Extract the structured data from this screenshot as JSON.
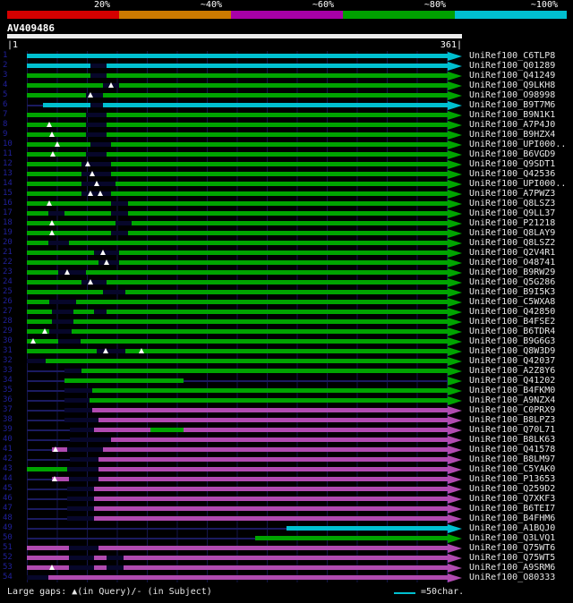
{
  "identity_scale": {
    "labels": [
      "20%",
      "~40%",
      "~60%",
      "~80%",
      "~100%"
    ],
    "colors": [
      "#d40000",
      "#cc7a00",
      "#a800a8",
      "#00a000",
      "#00c0d0"
    ]
  },
  "query": {
    "name": "AV409486",
    "start_label": "|1",
    "end_label": "361|",
    "length": 361
  },
  "footer": {
    "gaps_legend": "Large gaps: ▲(in Query)/- (in Subject)",
    "scale_label": "=50char."
  },
  "colors": {
    "cyan": "#00c0d0",
    "green": "#00a400",
    "magenta": "#b04ab0",
    "navy": "#07072a"
  },
  "hits": [
    {
      "n": 1,
      "label": "UniRef100_C6TLP8",
      "color": "cyan",
      "start": 0,
      "end": 1
    },
    {
      "n": 2,
      "label": "UniRef100_Q01289",
      "color": "cyan",
      "start": 0,
      "end": 1,
      "dark": [
        [
          0.15,
          0.19
        ]
      ]
    },
    {
      "n": 3,
      "label": "UniRef100_Q41249",
      "color": "green",
      "start": 0,
      "end": 1,
      "dark": [
        [
          0.15,
          0.19
        ]
      ]
    },
    {
      "n": 4,
      "label": "UniRef100_Q9LKH8",
      "color": "green",
      "start": 0,
      "end": 1,
      "dark": [
        [
          0.18,
          0.22
        ]
      ],
      "tri": [
        0.2
      ]
    },
    {
      "n": 5,
      "label": "UniRef100_O98998",
      "color": "green",
      "start": 0,
      "end": 1,
      "dark": [
        [
          0.14,
          0.18
        ]
      ],
      "tri": [
        0.15
      ]
    },
    {
      "n": 6,
      "label": "UniRef100_B9T7M6",
      "color": "cyan",
      "start": 0.038,
      "end": 1,
      "dark": [
        [
          0.15,
          0.18
        ]
      ],
      "line": [
        [
          0,
          0.038
        ]
      ]
    },
    {
      "n": 7,
      "label": "UniRef100_B9N1K1",
      "color": "green",
      "start": 0,
      "end": 1,
      "dark": [
        [
          0.14,
          0.19
        ]
      ]
    },
    {
      "n": 8,
      "label": "UniRef100_A7P4J0",
      "color": "green",
      "start": 0,
      "end": 1,
      "dark": [
        [
          0.14,
          0.19
        ]
      ],
      "tri": [
        0.053
      ]
    },
    {
      "n": 9,
      "label": "UniRef100_B9HZX4",
      "color": "green",
      "start": 0,
      "end": 1,
      "dark": [
        [
          0.14,
          0.19
        ]
      ],
      "tri": [
        0.06
      ]
    },
    {
      "n": 10,
      "label": "UniRef100_UPI000..",
      "color": "green",
      "start": 0,
      "end": 1,
      "dark": [
        [
          0.15,
          0.2
        ]
      ],
      "tri": [
        0.072
      ]
    },
    {
      "n": 11,
      "label": "UniRef100_B6VGD9",
      "color": "green",
      "start": 0,
      "end": 1,
      "dark": [
        [
          0.14,
          0.19
        ]
      ],
      "tri": [
        0.062
      ]
    },
    {
      "n": 12,
      "label": "UniRef100_Q9SDT1",
      "color": "green",
      "start": 0,
      "end": 1,
      "dark": [
        [
          0.13,
          0.2
        ]
      ],
      "tri": [
        0.145
      ]
    },
    {
      "n": 13,
      "label": "UniRef100_Q42536",
      "color": "green",
      "start": 0,
      "end": 1,
      "dark": [
        [
          0.13,
          0.2
        ]
      ],
      "tri": [
        0.155
      ]
    },
    {
      "n": 14,
      "label": "UniRef100_UPI000..",
      "color": "green",
      "start": 0,
      "end": 1,
      "dark": [
        [
          0.13,
          0.21
        ]
      ],
      "tri": [
        0.165
      ]
    },
    {
      "n": 15,
      "label": "UniRef100_A7PWZ3",
      "color": "green",
      "start": 0,
      "end": 1,
      "dark": [
        [
          0.13,
          0.2
        ]
      ],
      "tri": [
        0.15,
        0.175
      ]
    },
    {
      "n": 16,
      "label": "UniRef100_Q8LSZ3",
      "color": "green",
      "start": 0,
      "end": 1,
      "dark": [
        [
          0.2,
          0.24
        ]
      ],
      "tri": [
        0.053
      ]
    },
    {
      "n": 17,
      "label": "UniRef100_Q9LL37",
      "color": "green",
      "start": 0,
      "end": 1,
      "dark": [
        [
          0.05,
          0.09
        ],
        [
          0.2,
          0.24
        ]
      ]
    },
    {
      "n": 18,
      "label": "UniRef100_P21218",
      "color": "green",
      "start": 0,
      "end": 1,
      "dark": [
        [
          0.21,
          0.25
        ]
      ],
      "tri": [
        0.06
      ]
    },
    {
      "n": 19,
      "label": "UniRef100_Q8LAY9",
      "color": "green",
      "start": 0,
      "end": 1,
      "dark": [
        [
          0.2,
          0.24
        ]
      ],
      "tri": [
        0.06
      ]
    },
    {
      "n": 20,
      "label": "UniRef100_Q8LSZ2",
      "color": "green",
      "start": 0,
      "end": 1,
      "dark": [
        [
          0.05,
          0.1
        ]
      ]
    },
    {
      "n": 21,
      "label": "UniRef100_Q2V4R1",
      "color": "green",
      "start": 0,
      "end": 1,
      "dark": [
        [
          0.16,
          0.22
        ]
      ],
      "tri": [
        0.18
      ]
    },
    {
      "n": 22,
      "label": "UniRef100_O48741",
      "color": "green",
      "start": 0,
      "end": 1,
      "dark": [
        [
          0.17,
          0.22
        ]
      ],
      "tri": [
        0.19
      ]
    },
    {
      "n": 23,
      "label": "UniRef100_B9RW29",
      "color": "green",
      "start": 0,
      "end": 1,
      "dark": [
        [
          0.075,
          0.14
        ]
      ],
      "tri": [
        0.095
      ]
    },
    {
      "n": 24,
      "label": "UniRef100_Q5G286",
      "color": "green",
      "start": 0,
      "end": 1,
      "dark": [
        [
          0.13,
          0.19
        ]
      ],
      "tri": [
        0.15
      ]
    },
    {
      "n": 25,
      "label": "UniRef100_B9I5K3",
      "color": "green",
      "start": 0,
      "end": 1,
      "dark": [
        [
          0.18,
          0.235
        ]
      ]
    },
    {
      "n": 26,
      "label": "UniRef100_C5WXA8",
      "color": "green",
      "start": 0,
      "end": 1,
      "dark": [
        [
          0.053,
          0.117
        ]
      ]
    },
    {
      "n": 27,
      "label": "UniRef100_Q42850",
      "color": "green",
      "start": 0,
      "end": 1,
      "dark": [
        [
          0.06,
          0.11
        ],
        [
          0.16,
          0.19
        ]
      ]
    },
    {
      "n": 28,
      "label": "UniRef100_B4FSE2",
      "color": "green",
      "start": 0,
      "end": 1,
      "dark": [
        [
          0.06,
          0.11
        ]
      ]
    },
    {
      "n": 29,
      "label": "UniRef100_B6TDR4",
      "color": "green",
      "start": 0,
      "end": 1,
      "dark": [
        [
          0.053,
          0.106
        ]
      ],
      "tri": [
        0.043
      ]
    },
    {
      "n": 30,
      "label": "UniRef100_B9G6G3",
      "color": "green",
      "start": 0,
      "end": 1,
      "dark": [
        [
          0.075,
          0.128
        ]
      ],
      "tri": [
        0.015
      ]
    },
    {
      "n": 31,
      "label": "UniRef100_Q8W3D9",
      "color": "green",
      "start": 0,
      "end": 1,
      "dark": [
        [
          0.165,
          0.235
        ]
      ],
      "tri": [
        0.187,
        0.272
      ]
    },
    {
      "n": 32,
      "label": "UniRef100_Q42037",
      "color": "green",
      "start": 0,
      "end": 1,
      "dark": [
        [
          0,
          0.045
        ]
      ]
    },
    {
      "n": 33,
      "label": "UniRef100_A2Z8Y6",
      "color": "green",
      "start": 0.09,
      "end": 1,
      "dark": [
        [
          0.09,
          0.13
        ]
      ],
      "line": [
        [
          0,
          0.09
        ]
      ]
    },
    {
      "n": 34,
      "label": "UniRef100_Q41202",
      "color": "green",
      "start": 0.09,
      "end": 0.372,
      "line": [
        [
          0,
          0.09
        ],
        [
          0.372,
          1
        ]
      ]
    },
    {
      "n": 35,
      "label": "UniRef100_B4FKM0",
      "color": "green",
      "start": 0.09,
      "end": 1,
      "dark": [
        [
          0.09,
          0.155
        ]
      ],
      "line": [
        [
          0,
          0.09
        ]
      ]
    },
    {
      "n": 36,
      "label": "UniRef100_A9NZX4",
      "color": "green",
      "start": 0.09,
      "end": 1,
      "dark": [
        [
          0.09,
          0.15
        ]
      ],
      "line": [
        [
          0,
          0.09
        ]
      ]
    },
    {
      "n": 37,
      "label": "UniRef100_C0PRX9",
      "color": "magenta",
      "start": 0.09,
      "end": 1,
      "dark": [
        [
          0.09,
          0.155
        ]
      ],
      "line": [
        [
          0,
          0.09
        ]
      ]
    },
    {
      "n": 38,
      "label": "UniRef100_B8LPZ3",
      "color": "magenta",
      "start": 0.09,
      "end": 1,
      "dark": [
        [
          0.09,
          0.17
        ]
      ],
      "line": [
        [
          0,
          0.09
        ]
      ]
    },
    {
      "n": 39,
      "label": "UniRef100_Q70L71",
      "color": "magenta",
      "start": 0.102,
      "end": 1,
      "dark": [
        [
          0.102,
          0.16
        ]
      ],
      "line": [
        [
          0,
          0.102
        ]
      ],
      "extra": [
        {
          "s": 0.294,
          "e": 0.372,
          "color": "green"
        }
      ]
    },
    {
      "n": 40,
      "label": "UniRef100_B8LK63",
      "color": "magenta",
      "start": 0.102,
      "end": 1,
      "dark": [
        [
          0.102,
          0.2
        ]
      ],
      "line": [
        [
          0,
          0.102
        ]
      ]
    },
    {
      "n": 41,
      "label": "UniRef100_Q41578",
      "color": "magenta",
      "start": 0.06,
      "end": 1,
      "dark": [
        [
          0.096,
          0.18
        ]
      ],
      "tri": [
        0.068
      ],
      "line": [
        [
          0,
          0.06
        ]
      ]
    },
    {
      "n": 42,
      "label": "UniRef100_B8LM97",
      "color": "magenta",
      "start": 0.102,
      "end": 1,
      "dark": [
        [
          0.102,
          0.17
        ]
      ],
      "line": [
        [
          0,
          0.102
        ]
      ]
    },
    {
      "n": 43,
      "label": "UniRef100_C5YAK0",
      "color": "magenta",
      "start": 0.096,
      "end": 1,
      "dark": [
        [
          0.096,
          0.17
        ]
      ],
      "extra": [
        {
          "s": 0,
          "e": 0.096,
          "color": "green"
        }
      ]
    },
    {
      "n": 44,
      "label": "UniRef100_P13653",
      "color": "magenta",
      "start": 0.06,
      "end": 1,
      "dark": [
        [
          0.1,
          0.17
        ]
      ],
      "tri": [
        0.065
      ],
      "line": [
        [
          0,
          0.06
        ]
      ]
    },
    {
      "n": 45,
      "label": "UniRef100_Q259D2",
      "color": "magenta",
      "start": 0.096,
      "end": 1,
      "dark": [
        [
          0.096,
          0.16
        ]
      ],
      "line": [
        [
          0,
          0.096
        ]
      ]
    },
    {
      "n": 46,
      "label": "UniRef100_Q7XKF3",
      "color": "magenta",
      "start": 0.096,
      "end": 1,
      "dark": [
        [
          0.096,
          0.16
        ]
      ],
      "line": [
        [
          0,
          0.096
        ]
      ]
    },
    {
      "n": 47,
      "label": "UniRef100_B6TEI7",
      "color": "magenta",
      "start": 0.096,
      "end": 1,
      "dark": [
        [
          0.096,
          0.16
        ]
      ],
      "line": [
        [
          0,
          0.096
        ]
      ]
    },
    {
      "n": 48,
      "label": "UniRef100_B4FHM6",
      "color": "magenta",
      "start": 0.096,
      "end": 1,
      "dark": [
        [
          0.096,
          0.16
        ]
      ],
      "line": [
        [
          0,
          0.096
        ]
      ]
    },
    {
      "n": 49,
      "label": "UniRef100_A1BQJ0",
      "color": "cyan",
      "start": 0.617,
      "end": 1,
      "line": [
        [
          0,
          0.617
        ]
      ]
    },
    {
      "n": 50,
      "label": "UniRef100_Q3LVQ1",
      "color": "green",
      "start": 0.543,
      "end": 1,
      "line": [
        [
          0,
          0.543
        ]
      ]
    },
    {
      "n": 51,
      "label": "UniRef100_Q75WT6",
      "color": "magenta",
      "start": 0,
      "end": 1,
      "dark": [
        [
          0.1,
          0.17
        ]
      ]
    },
    {
      "n": 52,
      "label": "UniRef100_Q75WT5",
      "color": "magenta",
      "start": 0,
      "end": 1,
      "dark": [
        [
          0.1,
          0.16
        ],
        [
          0.19,
          0.23
        ]
      ]
    },
    {
      "n": 53,
      "label": "UniRef100_A9SRM6",
      "color": "magenta",
      "start": 0,
      "end": 1,
      "dark": [
        [
          0.1,
          0.16
        ],
        [
          0.19,
          0.23
        ]
      ],
      "tri": [
        0.06
      ]
    },
    {
      "n": 54,
      "label": "UniRef100_O80333",
      "color": "magenta",
      "start": 0,
      "end": 1,
      "dark": [
        [
          0,
          0.05
        ]
      ]
    }
  ]
}
